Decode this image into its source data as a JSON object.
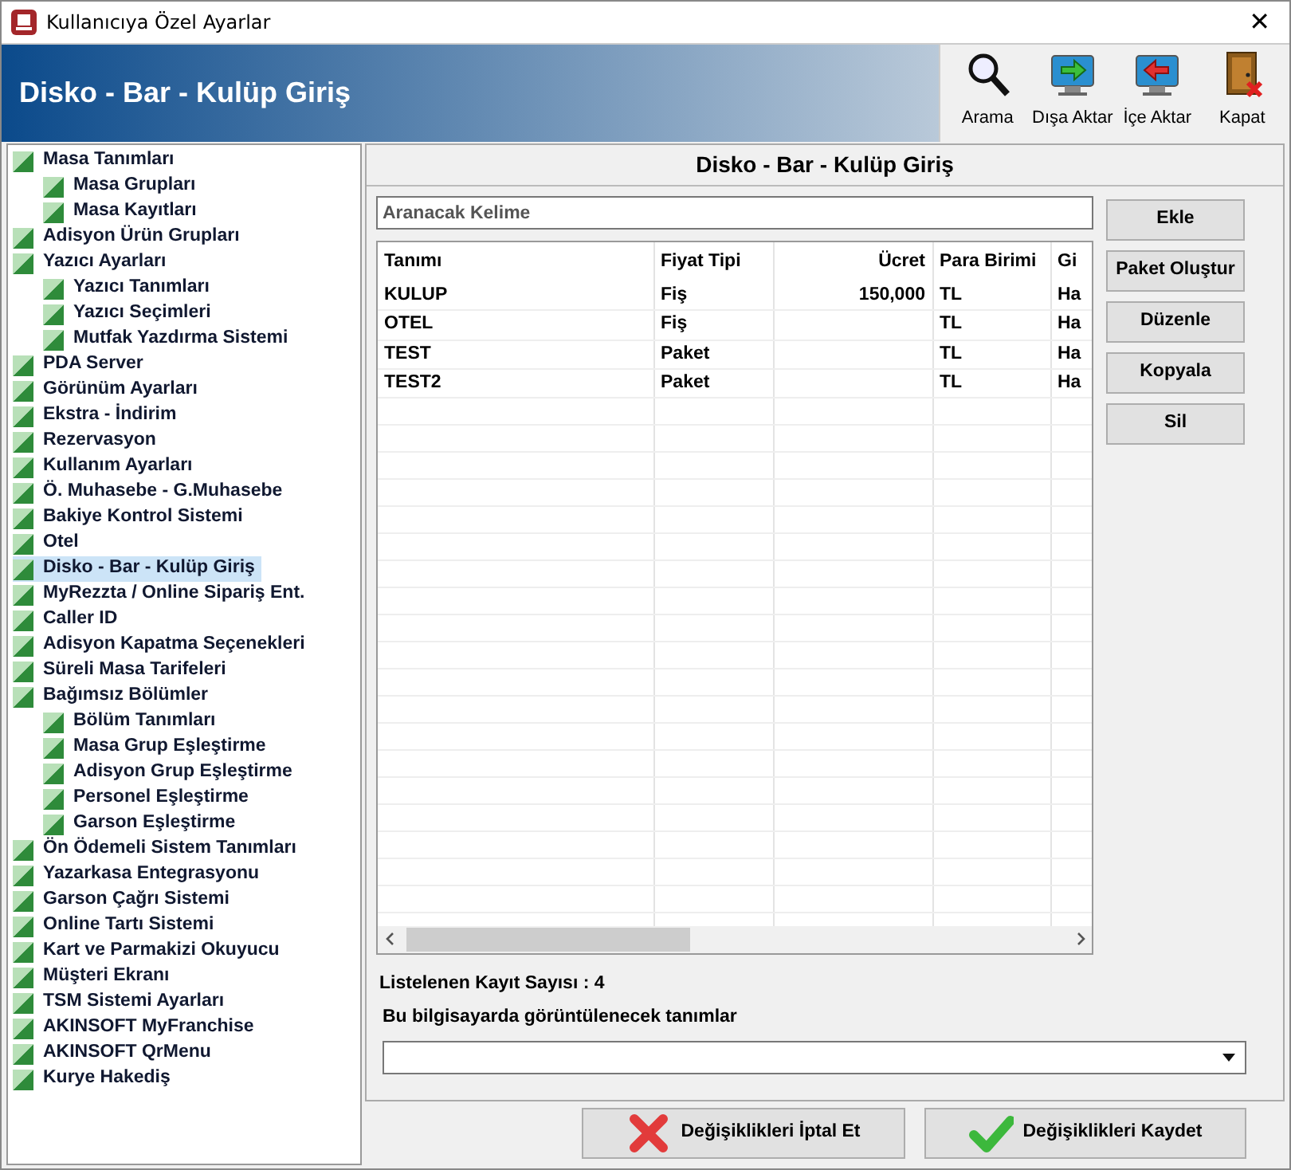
{
  "window": {
    "title": "Kullanıcıya Özel Ayarlar",
    "close": "✕"
  },
  "header": {
    "title": "Disko - Bar - Kulüp Giriş"
  },
  "toolbar": [
    {
      "label": "Arama"
    },
    {
      "label": "Dışa Aktar"
    },
    {
      "label": "İçe Aktar"
    },
    {
      "label": "Kapat"
    }
  ],
  "sidebar": {
    "items": [
      {
        "label": "Masa Tanımları",
        "selected": false,
        "children": [
          {
            "label": "Masa Grupları",
            "selected": false
          },
          {
            "label": "Masa Kayıtları",
            "selected": false
          }
        ]
      },
      {
        "label": "Adisyon Ürün Grupları",
        "selected": false
      },
      {
        "label": "Yazıcı Ayarları",
        "selected": false,
        "children": [
          {
            "label": "Yazıcı Tanımları",
            "selected": false
          },
          {
            "label": "Yazıcı Seçimleri",
            "selected": false
          },
          {
            "label": "Mutfak Yazdırma Sistemi",
            "selected": false
          }
        ]
      },
      {
        "label": "PDA Server",
        "selected": false
      },
      {
        "label": "Görünüm Ayarları",
        "selected": false
      },
      {
        "label": "Ekstra - İndirim",
        "selected": false
      },
      {
        "label": "Rezervasyon",
        "selected": false
      },
      {
        "label": "Kullanım Ayarları",
        "selected": false
      },
      {
        "label": "Ö. Muhasebe - G.Muhasebe",
        "selected": false
      },
      {
        "label": "Bakiye Kontrol Sistemi",
        "selected": false
      },
      {
        "label": "Otel",
        "selected": false
      },
      {
        "label": "Disko - Bar - Kulüp Giriş",
        "selected": true
      },
      {
        "label": "MyRezzta / Online Sipariş Ent.",
        "selected": false
      },
      {
        "label": "Caller ID",
        "selected": false
      },
      {
        "label": "Adisyon Kapatma Seçenekleri",
        "selected": false
      },
      {
        "label": "Süreli Masa Tarifeleri",
        "selected": false
      },
      {
        "label": "Bağımsız Bölümler",
        "selected": false,
        "children": [
          {
            "label": "Bölüm Tanımları",
            "selected": false
          },
          {
            "label": "Masa Grup Eşleştirme",
            "selected": false
          },
          {
            "label": "Adisyon Grup Eşleştirme",
            "selected": false
          },
          {
            "label": "Personel Eşleştirme",
            "selected": false
          },
          {
            "label": "Garson Eşleştirme",
            "selected": false
          }
        ]
      },
      {
        "label": "Ön Ödemeli Sistem Tanımları",
        "selected": false
      },
      {
        "label": "Yazarkasa Entegrasyonu",
        "selected": false
      },
      {
        "label": "Garson Çağrı Sistemi",
        "selected": false
      },
      {
        "label": "Online Tartı Sistemi",
        "selected": false
      },
      {
        "label": "Kart ve Parmakizi Okuyucu",
        "selected": false
      },
      {
        "label": "Müşteri Ekranı",
        "selected": false
      },
      {
        "label": "TSM Sistemi Ayarları",
        "selected": false
      },
      {
        "label": "AKINSOFT MyFranchise",
        "selected": false
      },
      {
        "label": "AKINSOFT QrMenu",
        "selected": false
      },
      {
        "label": "Kurye Hakediş",
        "selected": false
      }
    ]
  },
  "panel": {
    "title": "Disko - Bar - Kulüp Giriş",
    "search": {
      "placeholder": "Aranacak Kelime"
    },
    "table": {
      "columns": [
        "Tanımı",
        "Fiyat Tipi",
        "Ücret",
        "Para Birimi",
        "Gi"
      ],
      "rows": [
        [
          "KULUP",
          "Fiş",
          "150,000",
          "TL",
          "Ha"
        ],
        [
          "OTEL",
          "Fiş",
          "",
          "TL",
          "Ha"
        ],
        [
          "TEST",
          "Paket",
          "",
          "TL",
          "Ha"
        ],
        [
          "TEST2",
          "Paket",
          "",
          "TL",
          "Ha"
        ]
      ]
    },
    "actions": [
      "Ekle",
      "Paket Oluştur",
      "Düzenle",
      "Kopyala",
      "Sil"
    ],
    "record_count": "Listelenen Kayıt Sayısı : 4",
    "display_label": "Bu bilgisayarda görüntülenecek tanımlar"
  },
  "footer": {
    "buttons": [
      {
        "kind": "cancel",
        "label": "Değişiklikleri İptal Et"
      },
      {
        "kind": "save",
        "label": "Değişiklikleri Kaydet"
      }
    ]
  }
}
